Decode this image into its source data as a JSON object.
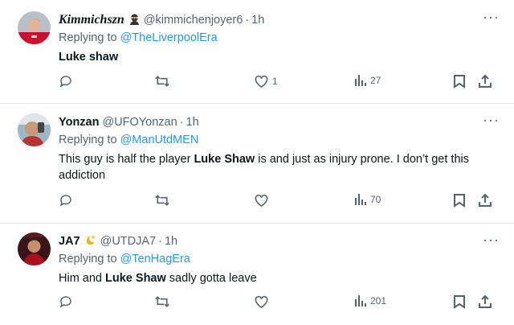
{
  "tweets": [
    {
      "display_name": "Kimmichszn",
      "handle": "@kimmichenjoyer6",
      "separator": "·",
      "time": "1h",
      "replying_prefix": "Replying to ",
      "replying_to": "@TheLiverpoolEra",
      "text_bold": "Luke shaw",
      "likes": "1",
      "views": "27"
    },
    {
      "display_name": "Yonzan",
      "handle": "@UFOYonzan",
      "separator": "·",
      "time": "1h",
      "replying_prefix": "Replying to ",
      "replying_to": "@ManUtdMEN",
      "text_part1": "This guy is half the player ",
      "text_bold": "Luke Shaw",
      "text_part2": " is and just as injury prone. I don’t get this addiction",
      "likes": "",
      "views": "70"
    },
    {
      "display_name": "JA7",
      "handle": "@UTDJA7",
      "separator": "·",
      "time": "1h",
      "replying_prefix": "Replying to ",
      "replying_to": "@TenHagEra",
      "text_part1": "Him and ",
      "text_bold": "Luke Shaw",
      "text_part2": " sadly gotta leave",
      "likes": "",
      "views": "201"
    }
  ],
  "more_label": "···",
  "icons": [
    "reply-icon",
    "retweet-icon",
    "like-icon",
    "views-icon",
    "bookmark-icon",
    "share-icon",
    "ninja-emoji-icon",
    "star-emoji-icon"
  ],
  "colors": {
    "link": "#1d9bf0",
    "muted": "#536471",
    "text": "#0f1419",
    "divider": "#e4e8eb"
  }
}
